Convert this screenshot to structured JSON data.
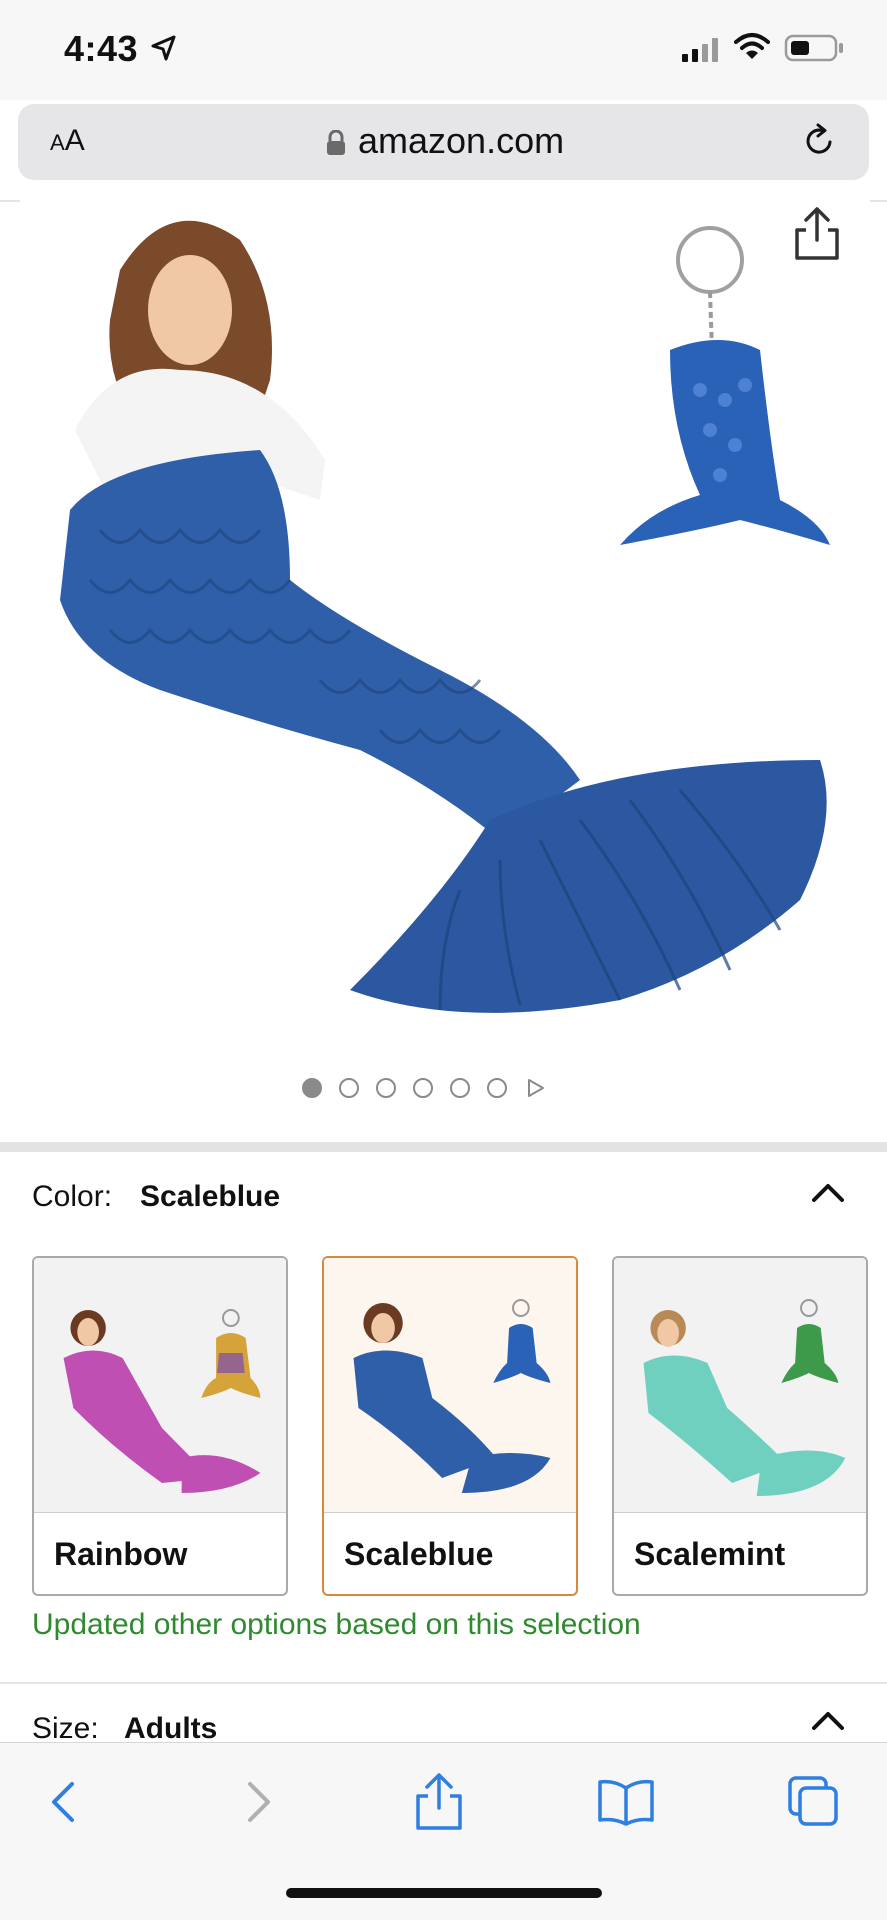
{
  "status_bar": {
    "time": "4:43",
    "icons": [
      "location-arrow-icon",
      "signal-icon",
      "wifi-icon",
      "battery-icon"
    ]
  },
  "browser": {
    "text_size_label_small": "A",
    "text_size_label_large": "A",
    "url": "amazon.com",
    "icons": [
      "lock-icon",
      "reload-icon"
    ]
  },
  "product": {
    "image_icon": "mermaid-blanket-image",
    "carousel": {
      "current_page": 1,
      "total_pages": 6
    },
    "share_icon": "share-icon"
  },
  "color_selector": {
    "label": "Color:",
    "selected": "Scaleblue",
    "options": [
      {
        "name": "Rainbow",
        "accent": "#c04fb4"
      },
      {
        "name": "Scaleblue",
        "accent": "#2f5fa8"
      },
      {
        "name": "Scalemint",
        "accent": "#6fd0c0"
      }
    ],
    "note": "Updated other options based on this selection"
  },
  "size_selector": {
    "label": "Size:",
    "selected": "Adults"
  },
  "toolbar": {
    "icons": [
      "back-icon",
      "forward-icon",
      "share-icon",
      "bookmarks-icon",
      "tabs-icon"
    ]
  },
  "colors": {
    "link_blue": "#2f7fe0",
    "note_green": "#2f8a2f",
    "selected_border": "#d88a3b",
    "blanket_blue": "#2f5fa8"
  }
}
